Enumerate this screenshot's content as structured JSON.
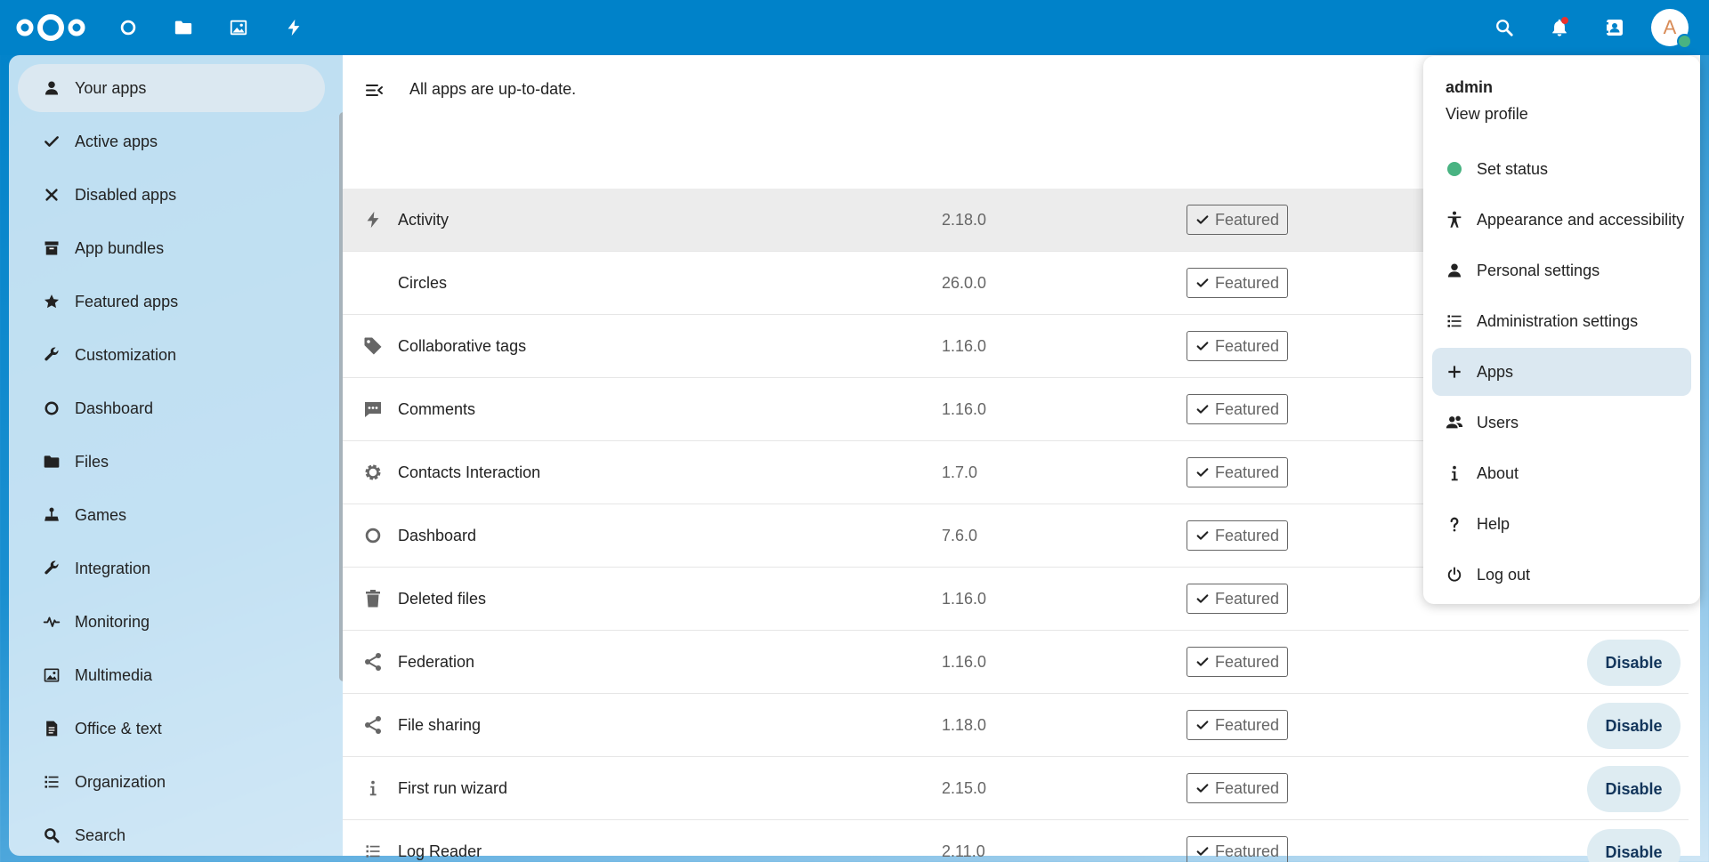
{
  "topbar": {
    "apps": [
      {
        "name": "dashboard-app",
        "icon": "circle-icon"
      },
      {
        "name": "files-app",
        "icon": "folder-icon"
      },
      {
        "name": "photos-app",
        "icon": "image-icon"
      },
      {
        "name": "activity-app",
        "icon": "bolt-icon"
      }
    ],
    "avatar_letter": "A"
  },
  "sidebar": {
    "items": [
      {
        "label": "Your apps",
        "icon": "person-icon",
        "active": true
      },
      {
        "label": "Active apps",
        "icon": "check-icon"
      },
      {
        "label": "Disabled apps",
        "icon": "close-icon"
      },
      {
        "label": "App bundles",
        "icon": "archive-icon"
      },
      {
        "label": "Featured apps",
        "icon": "star-icon"
      },
      {
        "label": "Customization",
        "icon": "wrench-icon"
      },
      {
        "label": "Dashboard",
        "icon": "circle-icon"
      },
      {
        "label": "Files",
        "icon": "folder-icon"
      },
      {
        "label": "Games",
        "icon": "joystick-icon"
      },
      {
        "label": "Integration",
        "icon": "wrench-icon"
      },
      {
        "label": "Monitoring",
        "icon": "pulse-icon"
      },
      {
        "label": "Multimedia",
        "icon": "image-icon"
      },
      {
        "label": "Office & text",
        "icon": "document-icon"
      },
      {
        "label": "Organization",
        "icon": "list-icon"
      },
      {
        "label": "Search",
        "icon": "search-icon"
      }
    ]
  },
  "main": {
    "status_text": "All apps are up-to-date.",
    "badge_label": "Featured",
    "disable_label": "Disable",
    "apps": [
      {
        "name": "Activity",
        "version": "2.18.0",
        "icon": "bolt-icon",
        "disable": false
      },
      {
        "name": "Circles",
        "version": "26.0.0",
        "icon": "",
        "disable": false
      },
      {
        "name": "Collaborative tags",
        "version": "1.16.0",
        "icon": "tag-icon",
        "disable": false
      },
      {
        "name": "Comments",
        "version": "1.16.0",
        "icon": "comment-icon",
        "disable": false
      },
      {
        "name": "Contacts Interaction",
        "version": "1.7.0",
        "icon": "gear-icon",
        "disable": false
      },
      {
        "name": "Dashboard",
        "version": "7.6.0",
        "icon": "circle-icon",
        "disable": false
      },
      {
        "name": "Deleted files",
        "version": "1.16.0",
        "icon": "trash-icon",
        "disable": false
      },
      {
        "name": "Federation",
        "version": "1.16.0",
        "icon": "share-icon",
        "disable": true
      },
      {
        "name": "File sharing",
        "version": "1.18.0",
        "icon": "share-icon",
        "disable": true
      },
      {
        "name": "First run wizard",
        "version": "2.15.0",
        "icon": "info-icon",
        "disable": true
      },
      {
        "name": "Log Reader",
        "version": "2.11.0",
        "icon": "list-icon",
        "disable": true
      }
    ]
  },
  "user_menu": {
    "username": "admin",
    "view_profile": "View profile",
    "items": [
      {
        "label": "Set status",
        "icon": "status-dot-icon"
      },
      {
        "label": "Appearance and accessibility",
        "icon": "accessibility-icon"
      },
      {
        "label": "Personal settings",
        "icon": "person-icon"
      },
      {
        "label": "Administration settings",
        "icon": "list-icon"
      },
      {
        "label": "Apps",
        "icon": "plus-icon",
        "active": true
      },
      {
        "label": "Users",
        "icon": "users-icon"
      },
      {
        "label": "About",
        "icon": "info-icon"
      },
      {
        "label": "Help",
        "icon": "help-icon"
      },
      {
        "label": "Log out",
        "icon": "power-icon"
      }
    ]
  },
  "colors": {
    "brand": "#0082c9",
    "online": "#49b382",
    "disable_bg": "#deecf2",
    "disable_text": "#12355b"
  }
}
